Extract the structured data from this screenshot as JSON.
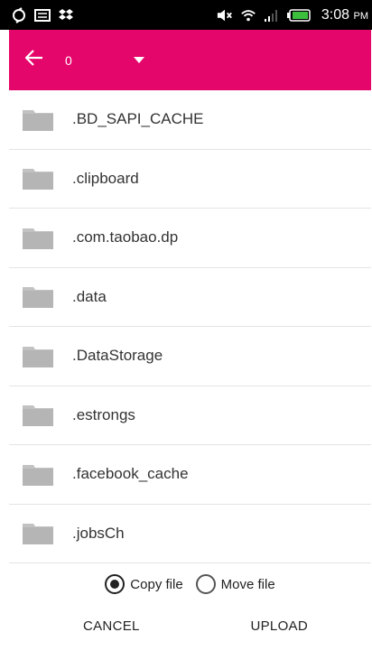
{
  "status_bar": {
    "time": "3:08",
    "ampm": "PM",
    "icons": [
      "sync-icon",
      "message-icon",
      "dropbox-icon",
      "mute-icon",
      "wifi-icon",
      "signal-icon",
      "battery-icon"
    ]
  },
  "toolbar": {
    "path_value": "0",
    "background_color": "#e5066b"
  },
  "files": [
    {
      "name": ".BD_SAPI_CACHE"
    },
    {
      "name": ".clipboard"
    },
    {
      "name": ".com.taobao.dp"
    },
    {
      "name": ".data"
    },
    {
      "name": ".DataStorage"
    },
    {
      "name": ".estrongs"
    },
    {
      "name": ".facebook_cache"
    },
    {
      "name": ".jobsCh"
    }
  ],
  "options": {
    "copy_label": "Copy file",
    "move_label": "Move file",
    "selected": "copy"
  },
  "actions": {
    "cancel_label": "CANCEL",
    "upload_label": "UPLOAD"
  }
}
